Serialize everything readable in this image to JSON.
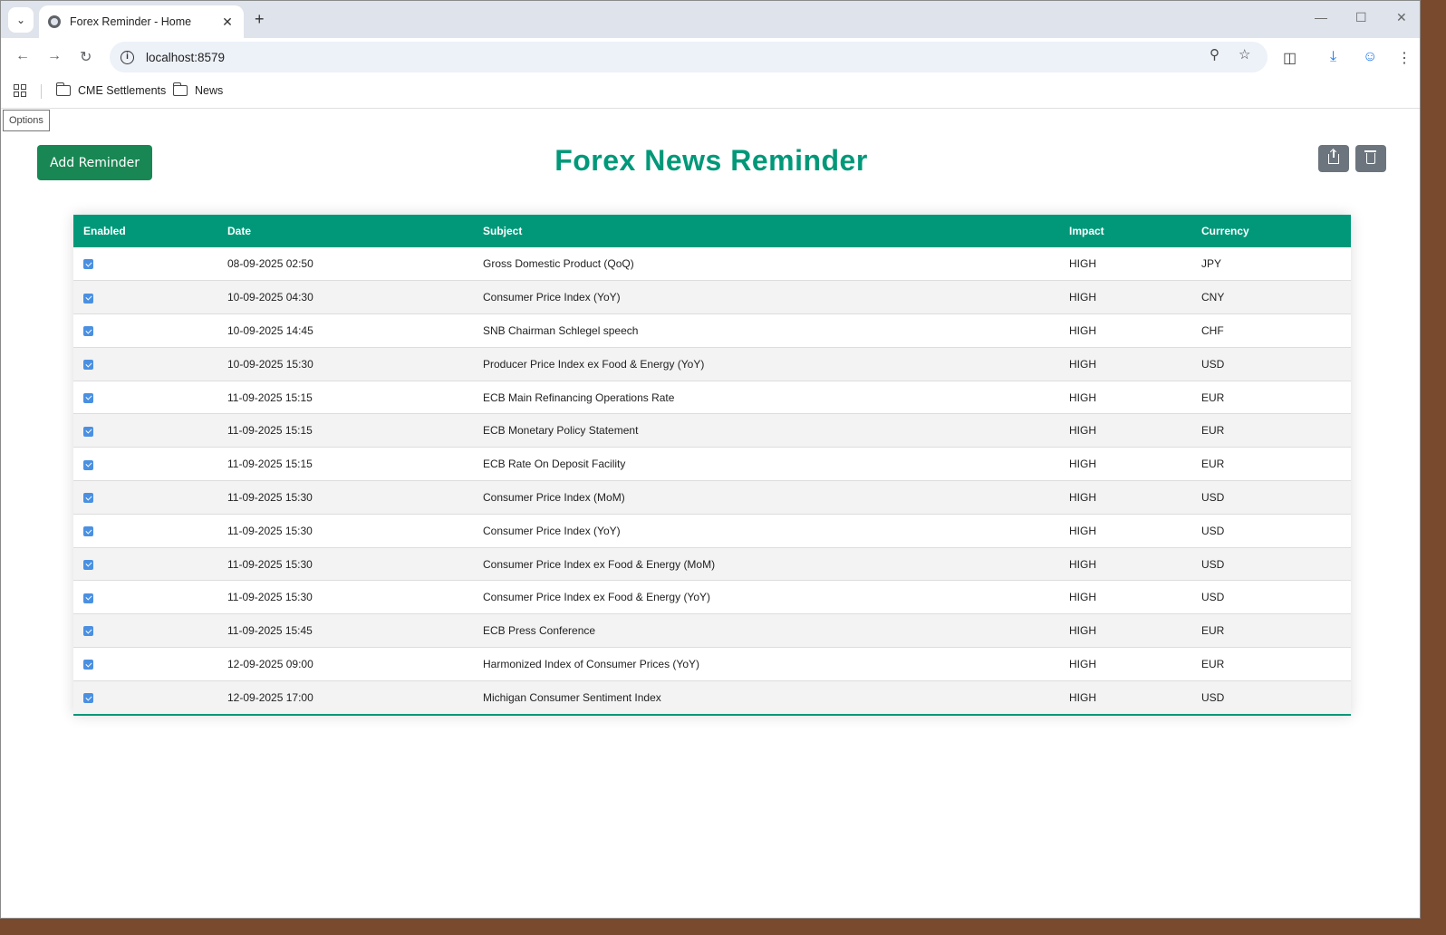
{
  "browser": {
    "tab_title": "Forex Reminder - Home",
    "url": "localhost:8579",
    "bookmarks": [
      {
        "label": "CME Settlements"
      },
      {
        "label": "News"
      }
    ]
  },
  "page": {
    "tooltip": "Options",
    "title": "Forex News Reminder",
    "add_button_label": "Add Reminder"
  },
  "table": {
    "columns": [
      "Enabled",
      "Date",
      "Subject",
      "Impact",
      "Currency"
    ],
    "rows": [
      {
        "enabled": true,
        "date": "08-09-2025 02:50",
        "subject": "Gross Domestic Product (QoQ)",
        "impact": "HIGH",
        "currency": "JPY"
      },
      {
        "enabled": true,
        "date": "10-09-2025 04:30",
        "subject": "Consumer Price Index (YoY)",
        "impact": "HIGH",
        "currency": "CNY"
      },
      {
        "enabled": true,
        "date": "10-09-2025 14:45",
        "subject": "SNB Chairman Schlegel speech",
        "impact": "HIGH",
        "currency": "CHF"
      },
      {
        "enabled": true,
        "date": "10-09-2025 15:30",
        "subject": "Producer Price Index ex Food & Energy (YoY)",
        "impact": "HIGH",
        "currency": "USD"
      },
      {
        "enabled": true,
        "date": "11-09-2025 15:15",
        "subject": "ECB Main Refinancing Operations Rate",
        "impact": "HIGH",
        "currency": "EUR"
      },
      {
        "enabled": true,
        "date": "11-09-2025 15:15",
        "subject": "ECB Monetary Policy Statement",
        "impact": "HIGH",
        "currency": "EUR"
      },
      {
        "enabled": true,
        "date": "11-09-2025 15:15",
        "subject": "ECB Rate On Deposit Facility",
        "impact": "HIGH",
        "currency": "EUR"
      },
      {
        "enabled": true,
        "date": "11-09-2025 15:30",
        "subject": "Consumer Price Index (MoM)",
        "impact": "HIGH",
        "currency": "USD"
      },
      {
        "enabled": true,
        "date": "11-09-2025 15:30",
        "subject": "Consumer Price Index (YoY)",
        "impact": "HIGH",
        "currency": "USD"
      },
      {
        "enabled": true,
        "date": "11-09-2025 15:30",
        "subject": "Consumer Price Index ex Food & Energy (MoM)",
        "impact": "HIGH",
        "currency": "USD"
      },
      {
        "enabled": true,
        "date": "11-09-2025 15:30",
        "subject": "Consumer Price Index ex Food & Energy (YoY)",
        "impact": "HIGH",
        "currency": "USD"
      },
      {
        "enabled": true,
        "date": "11-09-2025 15:45",
        "subject": "ECB Press Conference",
        "impact": "HIGH",
        "currency": "EUR"
      },
      {
        "enabled": true,
        "date": "12-09-2025 09:00",
        "subject": "Harmonized Index of Consumer Prices (YoY)",
        "impact": "HIGH",
        "currency": "EUR"
      },
      {
        "enabled": true,
        "date": "12-09-2025 17:00",
        "subject": "Michigan Consumer Sentiment Index",
        "impact": "HIGH",
        "currency": "USD"
      }
    ]
  },
  "colors": {
    "accent": "#009879",
    "add_button": "#198754",
    "icon_button": "#6c757d"
  }
}
